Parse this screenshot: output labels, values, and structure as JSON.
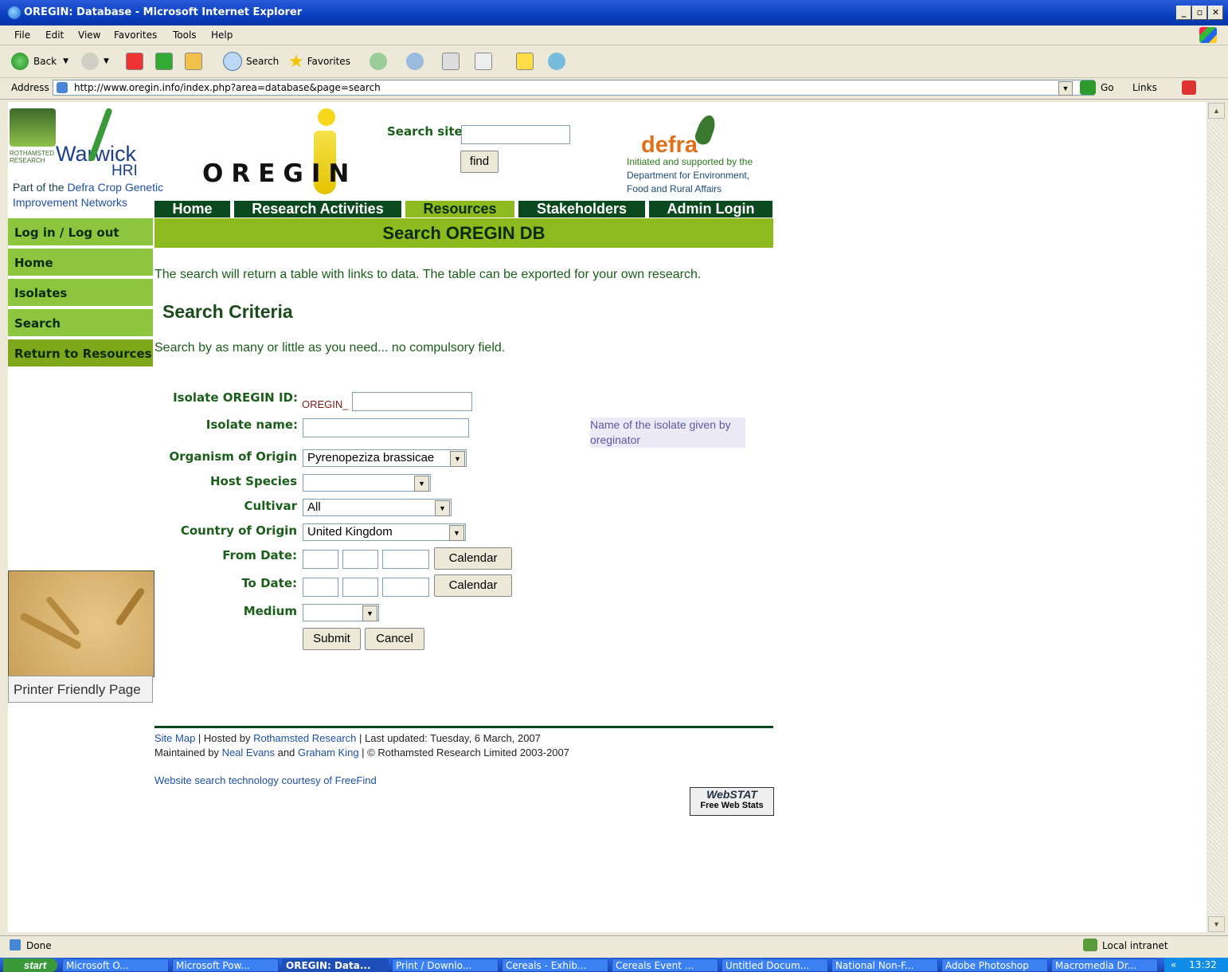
{
  "window": {
    "title": "OREGIN: Database - Microsoft Internet Explorer"
  },
  "menu": [
    "File",
    "Edit",
    "View",
    "Favorites",
    "Tools",
    "Help"
  ],
  "toolbar": {
    "back": "Back",
    "search": "Search",
    "favorites": "Favorites"
  },
  "address": {
    "label": "Address",
    "url": "http://www.oregin.info/index.php?area=database&page=search",
    "go": "Go",
    "links": "Links"
  },
  "header": {
    "warwick": "Warwick",
    "hri": "HRI",
    "rothamsted": "ROTHAMSTED RESEARCH",
    "part_of_prefix": "Part of the ",
    "part_of_link": "Defra Crop Genetic",
    "part_of_line2": "Improvement Networks",
    "oregin_logo": "OREGIN",
    "search_label": "Search site:",
    "find": "find",
    "defra": "defra",
    "defra_text1": "Initiated and supported by the",
    "defra_text2": "Department for Environment,",
    "defra_text3": "Food and Rural Affairs"
  },
  "nav": {
    "home": "Home",
    "research": "Research Activities",
    "resources": "Resources",
    "stakeholders": "Stakeholders",
    "admin": "Admin Login"
  },
  "sidebar": {
    "login": "Log in / Log out",
    "home": "Home",
    "isolates": "Isolates",
    "search": "Search",
    "return": "Return to Resources",
    "printer": "Printer Friendly Page"
  },
  "main": {
    "banner": "Search OREGIN DB",
    "intro": "The search will return a table with links to data. The table can be exported for your own research.",
    "criteria": "Search Criteria",
    "hint": "Search by as many or little as you need... no compulsory field."
  },
  "form": {
    "oregin_id_label": "Isolate OREGIN ID:",
    "oregin_prefix": "OREGIN_",
    "name_label": "Isolate name:",
    "name_help": "Name of the isolate given by oreginator",
    "organism_label": "Organism of Origin",
    "organism_value": "Pyrenopeziza brassicae",
    "host_label": "Host Species",
    "host_value": "",
    "cultivar_label": "Cultivar",
    "cultivar_value": "All",
    "country_label": "Country of Origin",
    "country_value": "United Kingdom",
    "from_label": "From Date:",
    "to_label": "To Date:",
    "calendar": "Calendar",
    "medium_label": "Medium",
    "medium_value": "",
    "submit": "Submit",
    "cancel": "Cancel"
  },
  "footer": {
    "sitemap": "Site Map",
    "hosted_by": " | Hosted by ",
    "rothamsted": "Rothamsted Research",
    "updated": " | Last updated: Tuesday, 6 March, 2007",
    "maintained": "Maintained by ",
    "neal": "Neal Evans",
    "and": " and ",
    "graham": "Graham King",
    "copyright": " | © Rothamsted Research Limited 2003-2007",
    "freefind": "Website search technology courtesy of FreeFind",
    "webstat1": "WebSTAT",
    "webstat2": "Free Web Stats"
  },
  "status": {
    "done": "Done",
    "zone": "Local intranet"
  },
  "taskbar": {
    "start": "start",
    "items": [
      "Microsoft O...",
      "Microsoft Pow...",
      "OREGIN: Data...",
      "Print / Downlo...",
      "Cereals - Exhib...",
      "Cereals Event ...",
      "Untitled Docum...",
      "National Non-F...",
      "Adobe Photoshop",
      "Macromedia Dr..."
    ],
    "clock": "13:32"
  }
}
